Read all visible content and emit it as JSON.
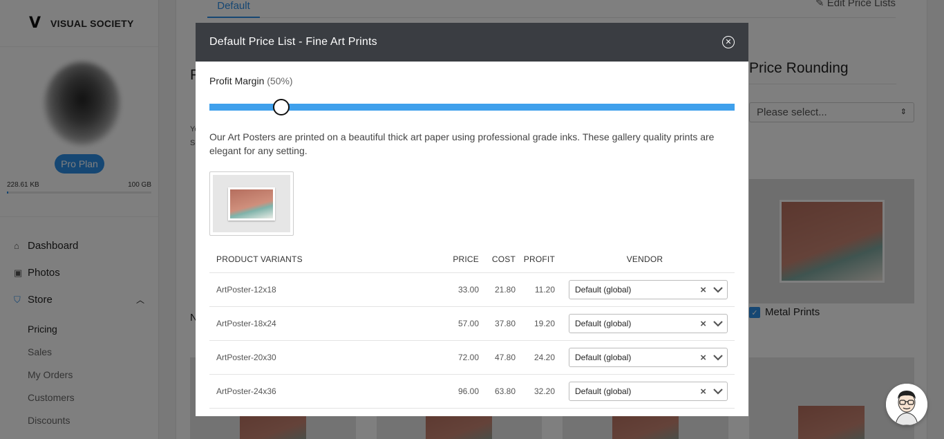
{
  "brand": {
    "logo": "V",
    "name": "VISUAL SOCIETY"
  },
  "profile": {
    "plan": "Pro Plan",
    "storage_used": "228.61 KB",
    "storage_total": "100 GB",
    "storage_fraction": 0.0
  },
  "sidebar": {
    "items": [
      {
        "label": "Dashboard",
        "icon": "home-icon"
      },
      {
        "label": "Photos",
        "icon": "image-icon"
      },
      {
        "label": "Store",
        "icon": "cart-icon"
      }
    ],
    "store_subitems": [
      "Pricing",
      "Sales",
      "My Orders",
      "Customers",
      "Discounts"
    ]
  },
  "background": {
    "tab_default": "Default",
    "edit_link": "Edit Price Lists",
    "price_rounding_title": "Price Rounding",
    "rounding_placeholder": "Please select...",
    "metal_prints_label": "Metal Prints",
    "fragments": {
      "p": "P",
      "n": "N",
      "y": "Yo",
      "s": "Se"
    }
  },
  "modal": {
    "title": "Default Price List - Fine Art Prints",
    "profit_margin_label": "Profit Margin",
    "profit_margin_pct": "(50%)",
    "slider_fraction": 0.137,
    "description": "Our Art Posters are printed on a beautiful thick art paper using professional grade inks. These gallery quality prints are elegant for any setting.",
    "table": {
      "headers": {
        "variant": "PRODUCT VARIANTS",
        "price": "PRICE",
        "cost": "COST",
        "profit": "PROFIT",
        "vendor": "VENDOR"
      },
      "rows": [
        {
          "variant": "ArtPoster-12x18",
          "price": "33.00",
          "cost": "21.80",
          "profit": "11.20",
          "vendor": "Default (global)"
        },
        {
          "variant": "ArtPoster-18x24",
          "price": "57.00",
          "cost": "37.80",
          "profit": "19.20",
          "vendor": "Default (global)"
        },
        {
          "variant": "ArtPoster-20x30",
          "price": "72.00",
          "cost": "47.80",
          "profit": "24.20",
          "vendor": "Default (global)"
        },
        {
          "variant": "ArtPoster-24x36",
          "price": "96.00",
          "cost": "63.80",
          "profit": "32.20",
          "vendor": "Default (global)"
        }
      ]
    }
  },
  "colors": {
    "accent": "#2d8ee6",
    "slider": "#3fa0ec",
    "modal_header": "#3a3d42"
  }
}
